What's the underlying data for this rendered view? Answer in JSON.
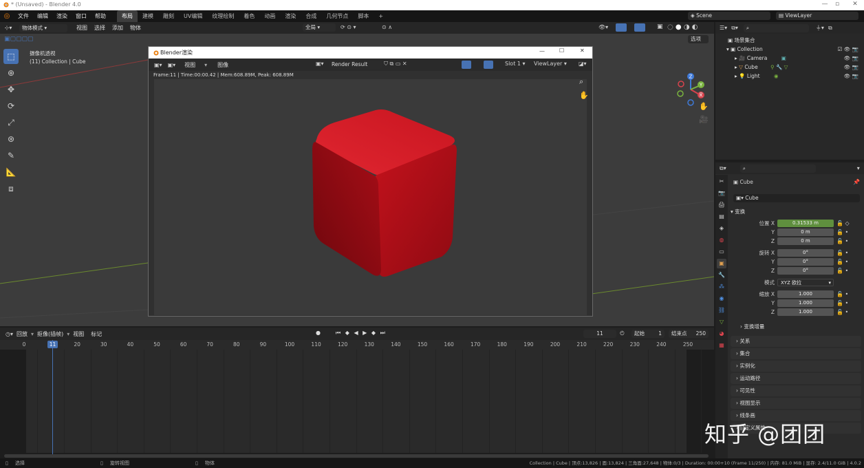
{
  "window": {
    "title": "* (Unsaved) - Blender 4.0"
  },
  "menubar": {
    "menus": [
      "文件",
      "编辑",
      "渲染",
      "窗口",
      "帮助"
    ],
    "workspaces": [
      "布局",
      "建模",
      "雕刻",
      "UV编辑",
      "纹理绘制",
      "着色",
      "动画",
      "渲染",
      "合成",
      "几何节点",
      "脚本"
    ],
    "active_workspace": 0,
    "add_tab": "+",
    "scene": "Scene",
    "viewlayer": "ViewLayer"
  },
  "viewport": {
    "mode": "物体模式",
    "menus": [
      "视图",
      "选择",
      "添加",
      "物体"
    ],
    "orientation": "全局",
    "options": "选项",
    "info_line1": "摄像机透视",
    "info_line2": "(11) Collection | Cube",
    "gizmo": {
      "x": "X",
      "y": "Y",
      "z": "Z"
    }
  },
  "render_window": {
    "title": "Blender渲染",
    "menus": [
      "视图",
      "图像"
    ],
    "image_name": "Render Result",
    "slot": "Slot 1",
    "view_layer": "ViewLayer",
    "stats": "Frame:11 | Time:00:00.42 | Mem:608.89M, Peak: 608.89M",
    "cube_color": "#c8141e"
  },
  "timeline": {
    "menus": [
      "回放",
      "抠像(插帧)",
      "视图",
      "标记"
    ],
    "current_frame": "11",
    "start_label": "起始",
    "start": "1",
    "end_label": "结束点",
    "end": "250",
    "ticks": [
      "0",
      "10",
      "20",
      "30",
      "40",
      "50",
      "60",
      "70",
      "80",
      "90",
      "100",
      "110",
      "120",
      "130",
      "140",
      "150",
      "160",
      "170",
      "180",
      "190",
      "200",
      "210",
      "220",
      "230",
      "240",
      "250"
    ]
  },
  "outliner": {
    "root": "场景集合",
    "collection": "Collection",
    "items": [
      {
        "name": "Camera",
        "color": "#e0a050"
      },
      {
        "name": "Cube",
        "color": "#e0a050"
      },
      {
        "name": "Light",
        "color": "#e0a050"
      }
    ]
  },
  "properties": {
    "object_name": "Cube",
    "data_name": "Cube",
    "transform_label": "变换",
    "location_label": "位置 X",
    "location": [
      "0.31533 m",
      "0 m",
      "0 m"
    ],
    "rotation_label": "旋转 X",
    "rotation": [
      "0°",
      "0°",
      "0°"
    ],
    "mode_label": "模式",
    "mode": "XYZ 欧拉",
    "scale_label": "缩放 X",
    "scale": [
      "1.000",
      "1.000",
      "1.000"
    ],
    "axis_y": "Y",
    "axis_z": "Z",
    "delta_label": "变换增量",
    "sections": [
      "关系",
      "集合",
      "实例化",
      "运动路径",
      "可见性",
      "视图显示",
      "线条画",
      "自定义属性"
    ]
  },
  "statusbar": {
    "left1": "选择",
    "left2": "旋转视图",
    "left3": "物体",
    "right": "Collection | Cube | 顶点:13,826 | 面:13,824 | 三角面:27,648 | 物体:0/3 | Duration: 00:00+10 (Frame 11/250) | 内存: 81.0 MiB | 显存: 2.4/11.0 GiB | 4.0.2"
  },
  "watermark": "知乎 @团团"
}
